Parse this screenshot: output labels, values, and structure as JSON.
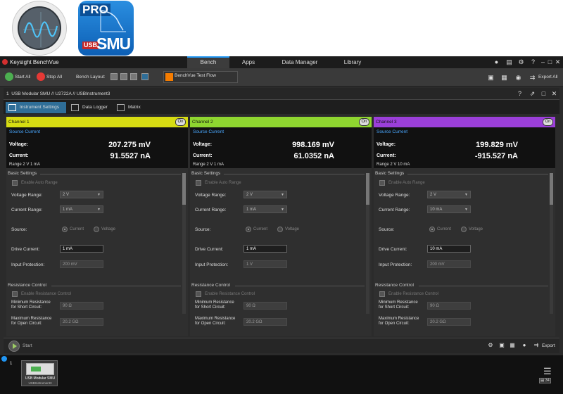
{
  "app": {
    "title": "Keysight BenchVue",
    "main_tabs": [
      "Bench",
      "Apps",
      "Data Manager",
      "Library"
    ]
  },
  "toolbar": {
    "start_all": "Start All",
    "stop_all": "Stop All",
    "bench_layout": "Bench Layout:",
    "test_flow": "BenchVue Test Flow",
    "export_all": "Export All"
  },
  "instrument": {
    "number": "1",
    "title": "USB Modular SMU // U2722A // USBInstrument3"
  },
  "subtabs": [
    "Instrument Settings",
    "Data Logger",
    "Matrix"
  ],
  "common": {
    "on": "On",
    "source_current": "Source Current",
    "voltage": "Voltage:",
    "current": "Current:",
    "basic_settings": "Basic Settings",
    "enable_auto_range": "Enable Auto Range",
    "voltage_range": "Voltage Range:",
    "current_range": "Current Range:",
    "source": "Source:",
    "opt_current": "Current",
    "opt_voltage": "Voltage",
    "drive_current": "Drive Current:",
    "input_protection": "Input Protection:",
    "resistance_control": "Resistance Control",
    "enable_resistance_control": "Enable Resistance Control",
    "min_res_1": "Minimum Resistance",
    "min_res_2": "for Short Circuit:",
    "max_res_1": "Maximum Resistance",
    "max_res_2": "for Open Circuit:"
  },
  "channels": [
    {
      "name": "Channel 1",
      "color": "#d7dc12",
      "voltage": "207.275 mV",
      "current": "91.5527 nA",
      "range": "Range   2 V   1 mA",
      "voltage_range": "2 V",
      "current_range": "1 mA",
      "drive_current": "1 mA",
      "input_protection": "200 mV",
      "min_res": "90 Ω",
      "max_res": "20.2 GΩ"
    },
    {
      "name": "Channel 2",
      "color": "#8fd630",
      "voltage": "998.169 mV",
      "current": "61.0352 nA",
      "range": "Range   2 V   1 mA",
      "voltage_range": "2 V",
      "current_range": "1 mA",
      "drive_current": "1 mA",
      "input_protection": "1 V",
      "min_res": "90 Ω",
      "max_res": "20.2 GΩ"
    },
    {
      "name": "Channel 3",
      "color": "#9b3fd9",
      "voltage": "199.829 mV",
      "current": "-915.527 nA",
      "range": "Range   2 V   10 mA",
      "voltage_range": "2 V",
      "current_range": "10 mA",
      "drive_current": "10 mA",
      "input_protection": "200 mV",
      "min_res": "90 Ω",
      "max_res": "20.2 GΩ"
    }
  ],
  "statusbar": {
    "start": "Start",
    "export": "Export"
  },
  "taskbar": {
    "number": "1",
    "name": "USB Modular SMU",
    "sub": "USBInstrument3",
    "counter": "34"
  },
  "logos": {
    "pro": "PRO",
    "usb": "USB",
    "smu": "SMU"
  }
}
